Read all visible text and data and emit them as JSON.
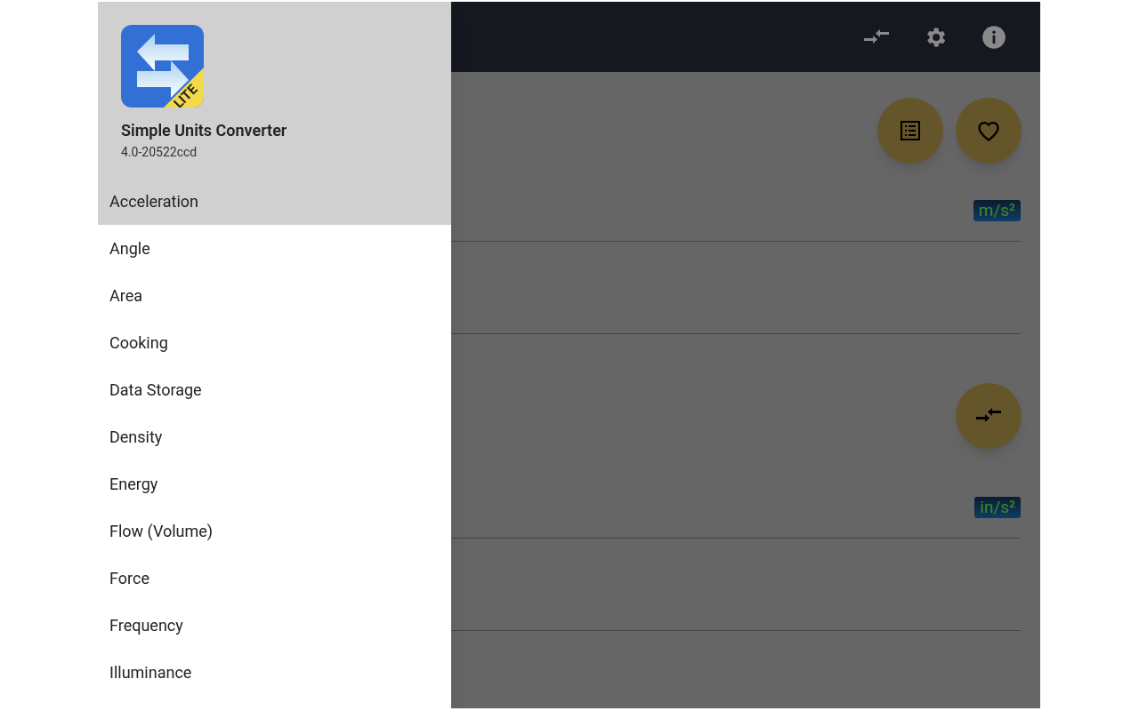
{
  "app_bar": {
    "actions": [
      {
        "kind": "swap"
      },
      {
        "kind": "settings"
      },
      {
        "kind": "info"
      }
    ]
  },
  "drawer": {
    "logo_badge": "LITE",
    "title": "Simple Units Converter",
    "version": "4.0-20522ccd",
    "items": [
      {
        "label": "Acceleration",
        "selected": true
      },
      {
        "label": "Angle",
        "selected": false
      },
      {
        "label": "Area",
        "selected": false
      },
      {
        "label": "Cooking",
        "selected": false
      },
      {
        "label": "Data Storage",
        "selected": false
      },
      {
        "label": "Density",
        "selected": false
      },
      {
        "label": "Energy",
        "selected": false
      },
      {
        "label": "Flow (Volume)",
        "selected": false
      },
      {
        "label": "Force",
        "selected": false
      },
      {
        "label": "Frequency",
        "selected": false
      },
      {
        "label": "Illuminance",
        "selected": false
      }
    ]
  },
  "fabs": [
    {
      "kind": "list"
    },
    {
      "kind": "favorite"
    }
  ],
  "converter": {
    "from_unit": "m/s²",
    "to_unit": "in/s²",
    "swap_button": {
      "kind": "swap"
    }
  }
}
